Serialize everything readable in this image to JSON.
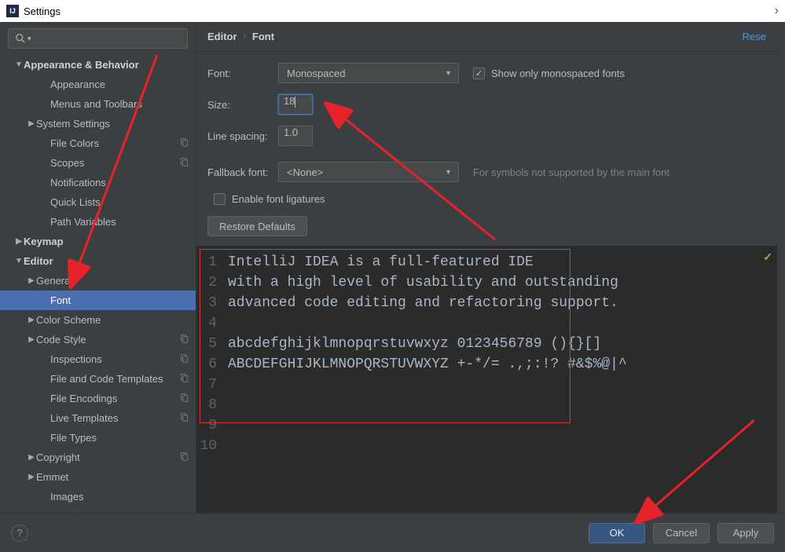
{
  "window": {
    "title": "Settings"
  },
  "sidebar": {
    "items": [
      {
        "label": "Appearance & Behavior",
        "level": 0,
        "expanded": true,
        "cfg": false
      },
      {
        "label": "Appearance",
        "level": 2,
        "cfg": false
      },
      {
        "label": "Menus and Toolbars",
        "level": 2,
        "cfg": false
      },
      {
        "label": "System Settings",
        "level": 1,
        "arrow": true,
        "cfg": false
      },
      {
        "label": "File Colors",
        "level": 2,
        "cfg": true
      },
      {
        "label": "Scopes",
        "level": 2,
        "cfg": true
      },
      {
        "label": "Notifications",
        "level": 2,
        "cfg": false
      },
      {
        "label": "Quick Lists",
        "level": 2,
        "cfg": false
      },
      {
        "label": "Path Variables",
        "level": 2,
        "cfg": false
      },
      {
        "label": "Keymap",
        "level": 0,
        "cfg": false
      },
      {
        "label": "Editor",
        "level": 0,
        "expanded": true,
        "cfg": false
      },
      {
        "label": "General",
        "level": 1,
        "arrow": true,
        "cfg": false
      },
      {
        "label": "Font",
        "level": 2,
        "cfg": false,
        "selected": true
      },
      {
        "label": "Color Scheme",
        "level": 1,
        "arrow": true,
        "cfg": false
      },
      {
        "label": "Code Style",
        "level": 1,
        "arrow": true,
        "cfg": true
      },
      {
        "label": "Inspections",
        "level": 2,
        "cfg": true
      },
      {
        "label": "File and Code Templates",
        "level": 2,
        "cfg": true
      },
      {
        "label": "File Encodings",
        "level": 2,
        "cfg": true
      },
      {
        "label": "Live Templates",
        "level": 2,
        "cfg": true
      },
      {
        "label": "File Types",
        "level": 2,
        "cfg": false
      },
      {
        "label": "Copyright",
        "level": 1,
        "arrow": true,
        "cfg": true
      },
      {
        "label": "Emmet",
        "level": 1,
        "arrow": true,
        "cfg": false
      },
      {
        "label": "Images",
        "level": 2,
        "cfg": false
      },
      {
        "label": "Intentions",
        "level": 2,
        "cfg": false
      }
    ]
  },
  "crumbs": {
    "a": "Editor",
    "b": "Font",
    "reset": "Rese"
  },
  "form": {
    "font_label": "Font:",
    "font_value": "Monospaced",
    "show_mono_label": "Show only monospaced fonts",
    "show_mono_checked": true,
    "size_label": "Size:",
    "size_value": "18",
    "line_spacing_label": "Line spacing:",
    "line_spacing_value": "1.0",
    "fallback_label": "Fallback font:",
    "fallback_value": "<None>",
    "fallback_hint": "For symbols not supported by the main font",
    "ligatures_label": "Enable font ligatures",
    "ligatures_checked": false,
    "restore_label": "Restore Defaults"
  },
  "preview": {
    "lines": [
      "IntelliJ IDEA is a full-featured IDE",
      "with a high level of usability and outstanding",
      "advanced code editing and refactoring support.",
      "",
      "abcdefghijklmnopqrstuvwxyz 0123456789 (){}[]",
      "ABCDEFGHIJKLMNOPQRSTUVWXYZ +-*/= .,;:!? #&$%@|^",
      "",
      "",
      "",
      ""
    ]
  },
  "buttons": {
    "ok": "OK",
    "cancel": "Cancel",
    "apply": "Apply",
    "help": "?"
  }
}
